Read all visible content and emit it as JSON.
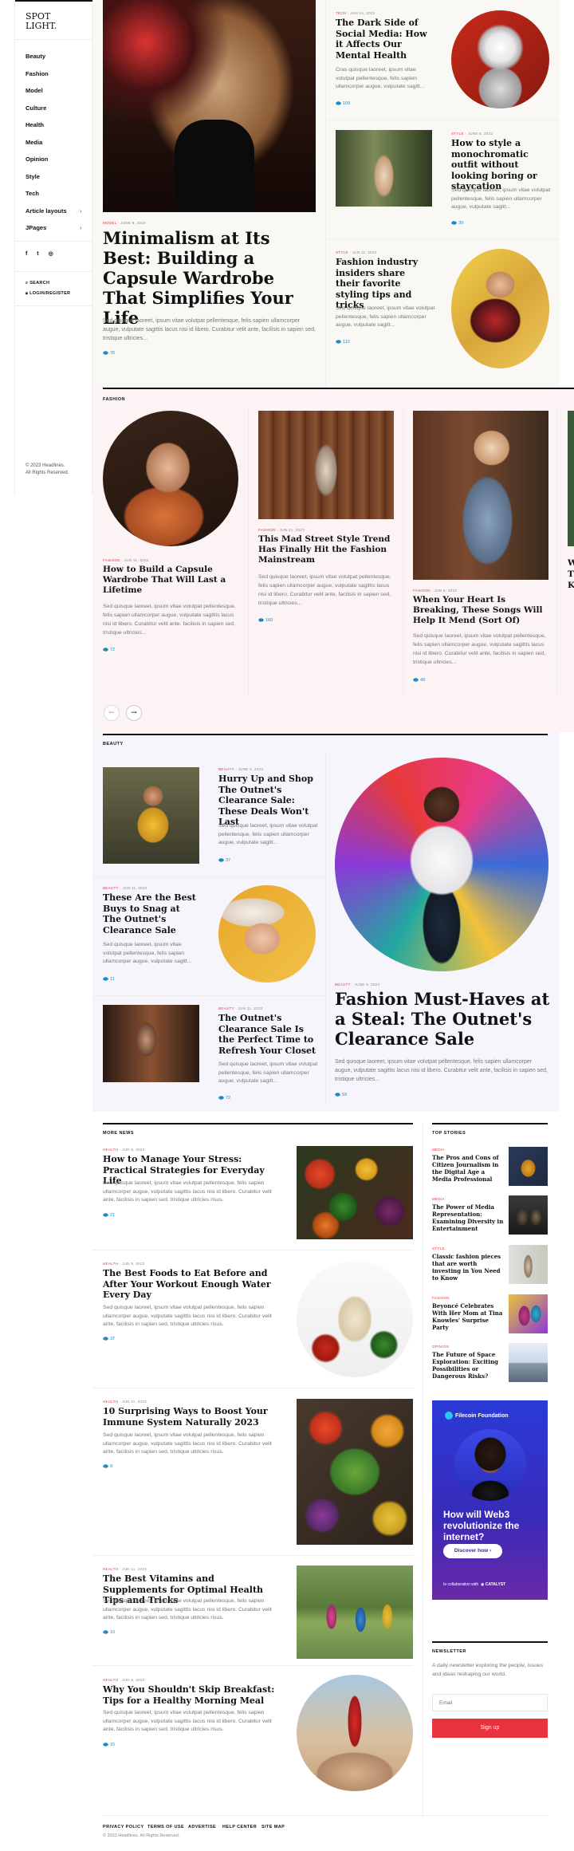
{
  "brand": {
    "line1": "SPOT",
    "line2": "LIGHT."
  },
  "nav": [
    {
      "label": "Beauty",
      "arrow": ""
    },
    {
      "label": "Fashion",
      "arrow": ""
    },
    {
      "label": "Model",
      "arrow": ""
    },
    {
      "label": "Culture",
      "arrow": ""
    },
    {
      "label": "Health",
      "arrow": ""
    },
    {
      "label": "Media",
      "arrow": ""
    },
    {
      "label": "Opinion",
      "arrow": ""
    },
    {
      "label": "Style",
      "arrow": ""
    },
    {
      "label": "Tech",
      "arrow": ""
    },
    {
      "label": "Article layouts",
      "arrow": "›"
    },
    {
      "label": "JPages",
      "arrow": "›"
    }
  ],
  "social": {
    "facebook": "f",
    "twitter": "t",
    "instagram": "◎"
  },
  "search_label": "SEARCH",
  "login_label": "LOGIN/REGISTER",
  "copyright": {
    "line1": "© 2023 Headlines.",
    "line2": "All Rights Reserved."
  },
  "excerpt_long": "Sed quisque laoreet, ipsum vitae volutpat pellentesque, felis sapien ullamcorper augue, vulputate sagittis lacus nisi id libero. Curabitur velit ante, facilisis in sapien sed, tristique ultricies...",
  "excerpt_short": "Cras quisque laoreet, ipsum vitae volutpat pellentesque, felis sapien ullamcorper augue, vulputate sagitt...",
  "excerpt_mid": "Sed quisque laoreet, ipsum vitae volutpat pellentesque, felis sapien ullamcorper augue, vulputate sagitt...",
  "excerpt_more": "Sed quisque laoreet, ipsum vitae volutpat pellentesque, felis sapien ullamcorper augue, vulputate sagittis lacus nisi id libero. Curabitur velit ante, facilisis in sapien sed, tristique ultricies risus.",
  "hero": {
    "main": {
      "cat": "MODEL",
      "date": "JUNE 8, 2023",
      "title": "Minimalism at Its Best: Building a Capsule Wardrobe That Simplifies Your Life",
      "views": "76"
    },
    "side": [
      {
        "cat": "TECH",
        "date": "JUN 15, 2023",
        "title": "The Dark Side of Social Media: How it Affects Our Mental Health",
        "views": "109"
      },
      {
        "cat": "STYLE",
        "date": "JUNE 8, 2023",
        "title": "How to style a monochromatic outfit without looking boring or staycation",
        "views": "39"
      },
      {
        "cat": "STYLE",
        "date": "JUN 11, 2023",
        "title": "Fashion industry insiders share their favorite styling tips and tricks",
        "views": "112"
      }
    ]
  },
  "fashion": {
    "section": "FASHION",
    "cards": [
      {
        "cat": "FASHION",
        "date": "JUN 11, 2023",
        "title": "How to Build a Capsule Wardrobe That Will Last a Lifetime",
        "views": "72"
      },
      {
        "cat": "FASHION",
        "date": "JUN 21, 2023",
        "title": "This Mad Street Style Trend Has Finally Hit the Fashion Mainstream",
        "views": "160"
      },
      {
        "cat": "FASHION",
        "date": "JUN 8, 2023",
        "title": "When Your Heart Is Breaking, These Songs Will Help It Mend (Sort Of)",
        "views": "49"
      }
    ],
    "edge_letters": [
      "W",
      "T",
      "K"
    ]
  },
  "beauty": {
    "section": "BEAUTY",
    "items": [
      {
        "cat": "BEAUTY",
        "date": "JUNE 8, 2023",
        "title": "Hurry Up and Shop The Outnet's Clearance Sale: These Deals Won't Last",
        "views": "37"
      },
      {
        "cat": "BEAUTY",
        "date": "JUN 11, 2023",
        "title": "These Are the Best Buys to Snag at The Outnet's Clearance Sale",
        "views": "11"
      },
      {
        "cat": "BEAUTY",
        "date": "JUN 11, 2023",
        "title": "The Outnet's Clearance Sale Is the Perfect Time to Refresh Your Closet",
        "views": "72"
      }
    ],
    "feature": {
      "cat": "BEAUTY",
      "date": "JUNE 8, 2023",
      "title": "Fashion Must-Haves at a Steal: The Outnet's Clearance Sale",
      "views": "59"
    }
  },
  "more_news": {
    "section": "MORE NEWS",
    "items": [
      {
        "cat": "HEALTH",
        "date": "JUN 8, 2023",
        "title": "How to Manage Your Stress: Practical Strategies for Everyday Life",
        "views": "21"
      },
      {
        "cat": "HEALTH",
        "date": "JUN 8, 2023",
        "title": "The Best Foods to Eat Before and After Your Workout Enough Water Every Day",
        "views": "37"
      },
      {
        "cat": "HEALTH",
        "date": "JUN 11, 2023",
        "title": "10 Surprising Ways to Boost Your Immune System Naturally 2023",
        "views": "9"
      },
      {
        "cat": "HEALTH",
        "date": "JUN 11, 2023",
        "title": "The Best Vitamins and Supplements for Optimal Health Tips and Tricks",
        "views": "10"
      },
      {
        "cat": "HEALTH",
        "date": "JUN 8, 2023",
        "title": "Why You Shouldn't Skip Breakfast: Tips for a Healthy Morning Meal",
        "views": "15"
      }
    ]
  },
  "top_stories": {
    "section": "TOP STORIES",
    "items": [
      {
        "cat": "MEDIA",
        "title": "The Pros and Cons of Citizen Journalism in the Digital Age a Media Professional"
      },
      {
        "cat": "MEDIA",
        "title": "The Power of Media Representation: Examining Diversity in Entertainment"
      },
      {
        "cat": "STYLE",
        "title": "Classic fashion pieces that are worth investing in You Need to Know"
      },
      {
        "cat": "FASHION",
        "title": "Beyoncé Celebrates With Her Mom at Tina Knowles' Surprise Party"
      },
      {
        "cat": "OPINION",
        "title": "The Future of Space Exploration: Exciting Possibilities or Dangerous Risks?"
      }
    ]
  },
  "ad": {
    "brand": "Filecoin Foundation",
    "headline": "How will Web3 revolutionize the internet?",
    "button": "Discover how ›",
    "collab": "In collaboration with",
    "partner": "CATALYST"
  },
  "newsletter": {
    "section": "NEWSLETTER",
    "text": "A daily newsletter exploring the people, issues and ideas reshaping our world.",
    "placeholder": "Email",
    "button": "Sign up"
  },
  "footer": {
    "links": [
      "PRIVACY POLICY",
      "TERMS OF USE",
      "ADVERTISE",
      "HELP CENTER",
      "SITE MAP"
    ],
    "copyright": "© 2023 Headlines. All Rights Reserved."
  },
  "colors": {
    "accent": "#e8333e",
    "views": "#1e88c8",
    "dark": "#111111"
  }
}
